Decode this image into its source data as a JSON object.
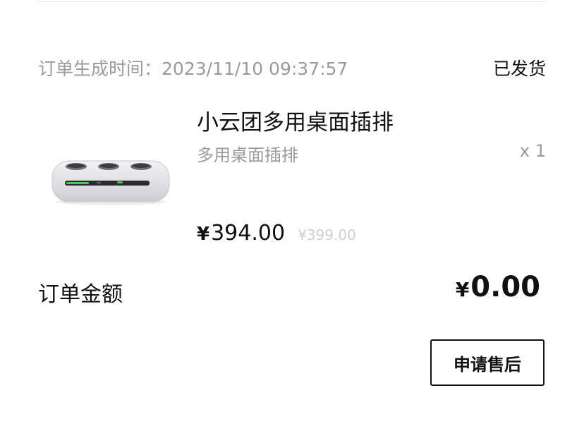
{
  "order": {
    "time_label": "订单生成时间：",
    "time_value": "2023/11/10 09:37:57",
    "status": "已发货"
  },
  "product": {
    "name": "小云团多用桌面插排",
    "spec": "多用桌面插排",
    "quantity": "x 1",
    "currency_symbol": "¥",
    "price": "394.00",
    "original_price": "¥399.00",
    "image_icon": "power-strip-image"
  },
  "summary": {
    "total_label": "订单金额",
    "currency_symbol": "¥",
    "total_value": "0.00"
  },
  "actions": {
    "after_sale_label": "申请售后"
  },
  "colors": {
    "text_primary": "#111111",
    "text_secondary": "#9b9b9b",
    "text_strikethrough": "#cfcfcf",
    "divider": "#e8e8e8"
  }
}
